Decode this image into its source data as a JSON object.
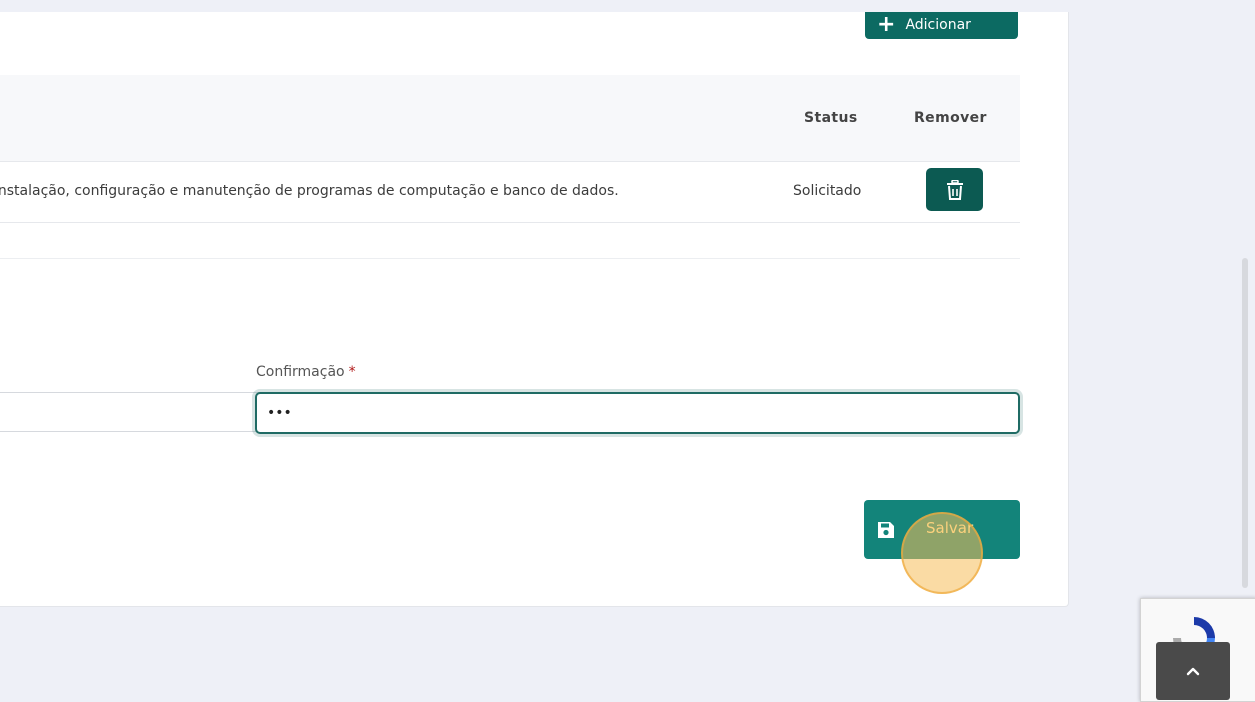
{
  "toolbar": {
    "add_label": "Adicionar"
  },
  "table": {
    "headers": {
      "status": "Status",
      "remove": "Remover"
    },
    "rows": [
      {
        "description": "instalação, configuração e manutenção de programas de computação e banco de dados.",
        "status": "Solicitado"
      }
    ]
  },
  "form": {
    "confirm_label": "Confirmação",
    "required_mark": "*",
    "confirm_value": "•••",
    "save_label": "Salvar"
  },
  "colors": {
    "primary": "#0c6a62",
    "save_button": "#13847a",
    "required": "#b01818",
    "click_highlight": "#f6be5a"
  },
  "icons": {
    "add": "plus-icon",
    "remove": "trash-icon",
    "save": "floppy-disk-icon",
    "back_to_top": "chevron-up-icon"
  }
}
